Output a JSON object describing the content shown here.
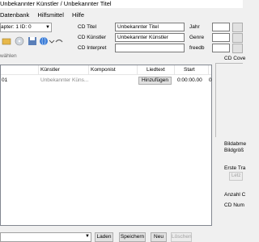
{
  "window": {
    "title": "Unbekannter Künstler / Unbekannter Titel"
  },
  "menu": [
    "Datenbank",
    "Hilfsmittel",
    "Hilfe"
  ],
  "toolbar": {
    "track_combo": "apter: 1  ID: 0",
    "select_all_text": "wählen"
  },
  "fields": {
    "cd_title": {
      "label": "CD Titel",
      "value": "Unbekannter Titel"
    },
    "cd_artist": {
      "label": "CD Künstler",
      "value": "Unbekannter Künstler"
    },
    "cd_interpret": {
      "label": "CD Interpret",
      "value": ""
    },
    "year": {
      "label": "Jahr"
    },
    "genre": {
      "label": "Genre"
    },
    "freedb": {
      "label": "freedb"
    }
  },
  "table": {
    "columns": [
      "Künstler",
      "Komponist",
      "Liedtext",
      "Start"
    ],
    "rows": [
      {
        "num": "01",
        "artist": "Unbekannter Küns...",
        "composer": "",
        "lyrics_button": "Hinzufügen",
        "start": "0:00:00.00",
        "extra": "0"
      }
    ]
  },
  "right_panel": {
    "cover_label": "CD Cove",
    "image_size_label": "Bildabme",
    "image_size_label2": "Bildgröß",
    "first_track_label": "Erste Tra",
    "first_track_button": "Letz",
    "count_label": "Anzahl C",
    "cd_number_label": "CD Num"
  },
  "bottom": {
    "load": "Laden",
    "save": "Speichern",
    "new": "Neu",
    "delete": "Löschen"
  },
  "colors": {
    "icon_globe": "#3b7dd8",
    "icon_red": "#d63a2e",
    "icon_folder": "#e8b84a"
  }
}
